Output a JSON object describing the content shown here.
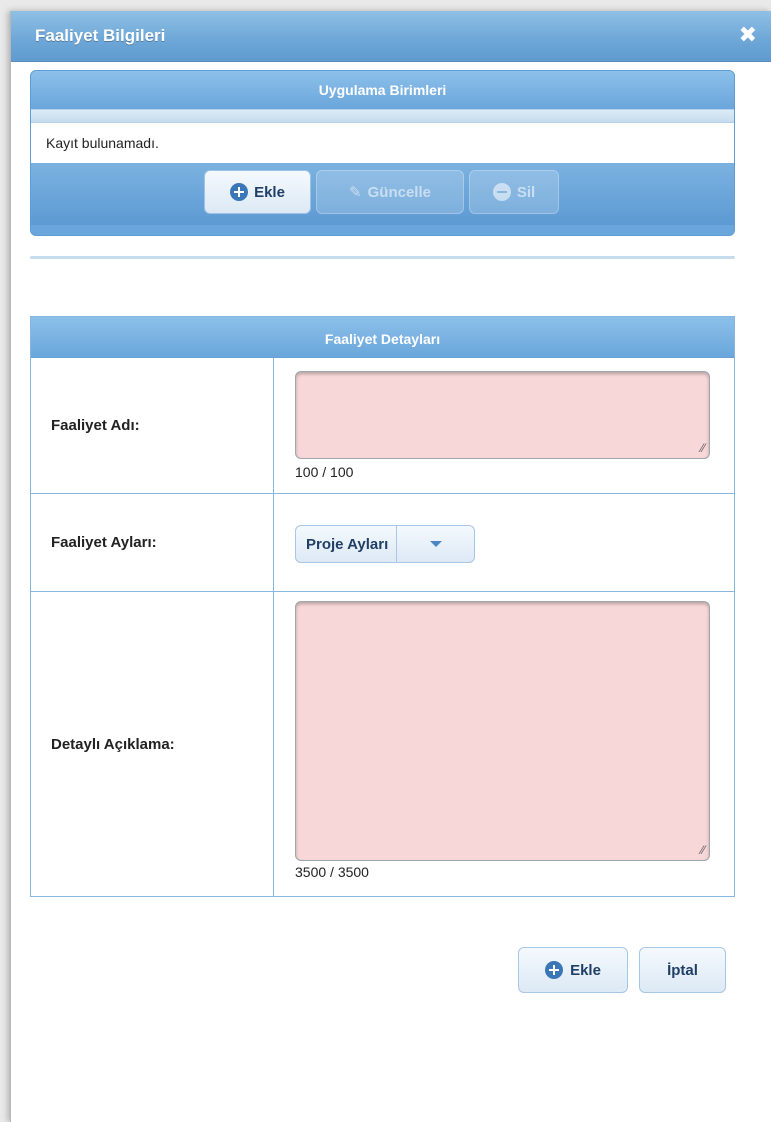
{
  "dialog": {
    "title": "Faaliyet Bilgileri",
    "close_symbol": "✖"
  },
  "units_panel": {
    "title": "Uygulama Birimleri",
    "empty_text": "Kayıt bulunamadı.",
    "buttons": {
      "add": "Ekle",
      "update": "Güncelle",
      "delete": "Sil"
    }
  },
  "details_panel": {
    "title": "Faaliyet Detayları",
    "activity_name": {
      "label": "Faaliyet Adı:",
      "value": "",
      "counter": "100 / 100"
    },
    "activity_months": {
      "label": "Faaliyet Ayları:",
      "selected": "Proje Ayları"
    },
    "description": {
      "label": "Detaylı Açıklama:",
      "value": "",
      "counter": "3500 / 3500"
    }
  },
  "footer": {
    "save_label": "Ekle",
    "cancel_label": "İptal"
  },
  "colors": {
    "header_blue": "#6aa6db",
    "required_field_bg": "#f7d7d7"
  }
}
